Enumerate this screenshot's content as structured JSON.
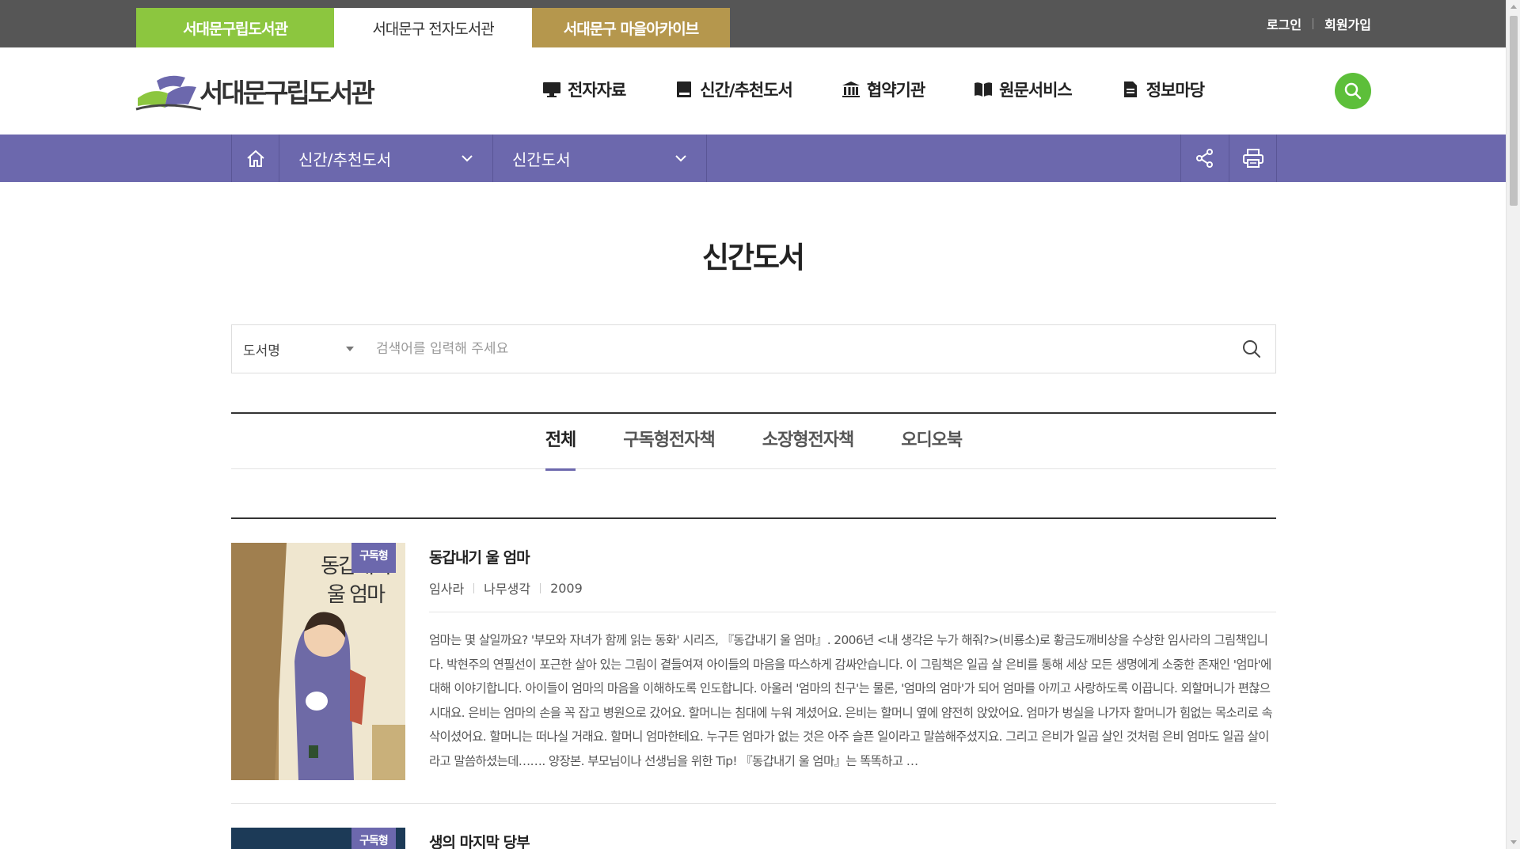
{
  "topbar": {
    "site_tabs": [
      {
        "label": "서대문구립도서관"
      },
      {
        "label": "서대문구 전자도서관"
      },
      {
        "label": "서대문구 마을아카이브"
      }
    ],
    "login": "로그인",
    "signup": "회원가입"
  },
  "header": {
    "logo_text": "서대문구립도서관",
    "gnb": [
      {
        "label": "전자자료",
        "icon": "monitor-icon"
      },
      {
        "label": "신간/추천도서",
        "icon": "book-icon"
      },
      {
        "label": "협약기관",
        "icon": "institution-icon"
      },
      {
        "label": "원문서비스",
        "icon": "open-book-icon"
      },
      {
        "label": "정보마당",
        "icon": "document-icon"
      }
    ],
    "search_icon": "search-icon"
  },
  "location": {
    "depth1": "신간/추천도서",
    "depth2": "신간도서"
  },
  "page_title": "신간도서",
  "search": {
    "field": "도서명",
    "placeholder": "검색어를 입력해 주세요"
  },
  "tabs": [
    {
      "label": "전체",
      "active": true
    },
    {
      "label": "구독형전자책"
    },
    {
      "label": "소장형전자책"
    },
    {
      "label": "오디오북"
    }
  ],
  "books": [
    {
      "badge": "구독형",
      "title": "동갑내기 울 엄마",
      "author": "임사라",
      "publisher": "나무생각",
      "year": "2009",
      "cover_text": "동갑내기 울 엄마",
      "description": "엄마는 몇 살일까요? '부모와 자녀가 함께 읽는 동화' 시리즈, 『동갑내기 울 엄마』. 2006년 <내 생각은 누가 해줘?>(비룡소)로 황금도깨비상을 수상한 임사라의 그림책입니다. 박현주의 연필선이 포근한 살아 있는 그림이 곁들여져 아이들의 마음을 따스하게 감싸안습니다. 이 그림책은 일곱 살 은비를 통해 세상 모든 생명에게 소중한 존재인 '엄마'에 대해 이야기합니다. 아이들이 엄마의 마음을 이해하도록 인도합니다. 아울러 '엄마의 친구'는 물론, '엄마의 엄마'가 되어 엄마를 아끼고 사랑하도록 이끕니다. 외할머니가 편찮으시대요. 은비는 엄마의 손을 꼭 잡고 병원으로 갔어요. 할머니는 침대에 누워 계셨어요. 은비는 할머니 옆에 얌전히 앉았어요. 엄마가 벙실을 나가자 할머니가 힘없는 목소리로 속삭이셨어요. 할머니는 떠나실 거래요. 할머니 엄마한테요. 누구든 엄마가 없는 것은 아주 슬픈 일이라고 말씀해주셨지요. 그리고 은비가 일곱 살인 것처럼 은비 엄마도 일곱 살이라고 말씀하셨는데……. 양장본. 부모님이나 선생님을 위한 Tip! 『동갑내기 울 엄마』는 똑똑하고 …"
    },
    {
      "badge": "구독형",
      "title": "생의 마지막 당부"
    }
  ]
}
